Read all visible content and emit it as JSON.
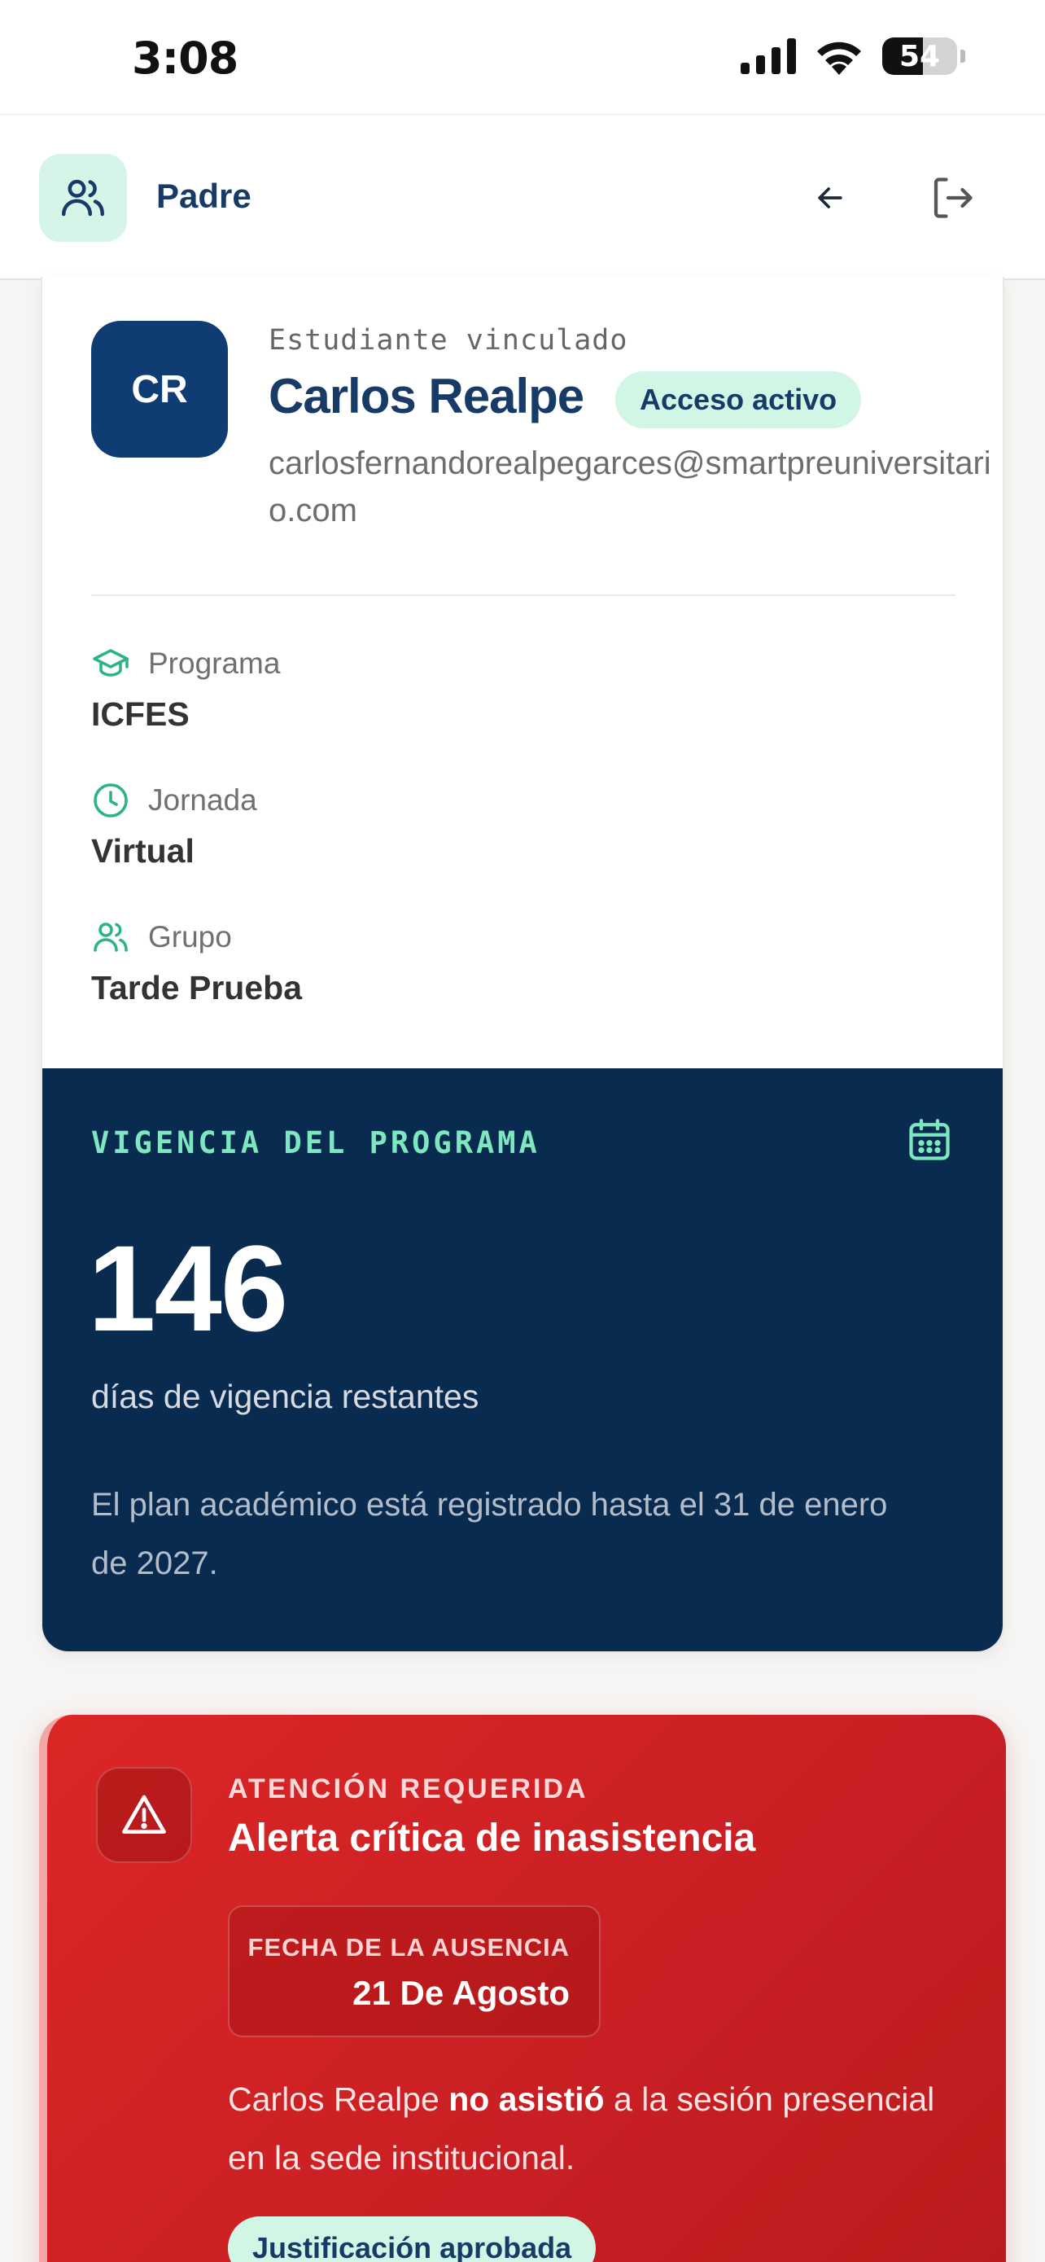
{
  "status_bar": {
    "time": "3:08",
    "battery": "54",
    "battery_level": 0.54
  },
  "header": {
    "role": "Padre"
  },
  "student": {
    "section_label": "Estudiante vinculado",
    "initials": "CR",
    "name": "Carlos Realpe",
    "access_badge": "Acceso activo",
    "email": "carlosfernandorealpegarces@smartpreuniversitario.com",
    "fields": [
      {
        "icon": "graduation-cap-icon",
        "label": "Programa",
        "value": "ICFES"
      },
      {
        "icon": "clock-icon",
        "label": "Jornada",
        "value": "Virtual"
      },
      {
        "icon": "users-icon",
        "label": "Grupo",
        "value": "Tarde Prueba"
      }
    ]
  },
  "validity": {
    "title": "VIGENCIA DEL PROGRAMA",
    "days": "146",
    "days_label": "días de vigencia restantes",
    "note": "El plan académico está registrado hasta el 31 de enero de 2027."
  },
  "alert": {
    "kicker": "ATENCIÓN REQUERIDA",
    "title": "Alerta crítica de inasistencia",
    "absence_label": "FECHA DE LA AUSENCIA",
    "absence_date": "21 De Agosto",
    "message_before": "Carlos Realpe ",
    "message_bold": "no asistió",
    "message_after": " a la sesión presencial en la sede institucional.",
    "badge": "Justificación aprobada"
  },
  "colors": {
    "navy": "#0a2b50",
    "brand_blue": "#173b66",
    "mint": "#d2f6e6",
    "accent_green": "#2bb583",
    "alert_red": "#dc2626"
  }
}
